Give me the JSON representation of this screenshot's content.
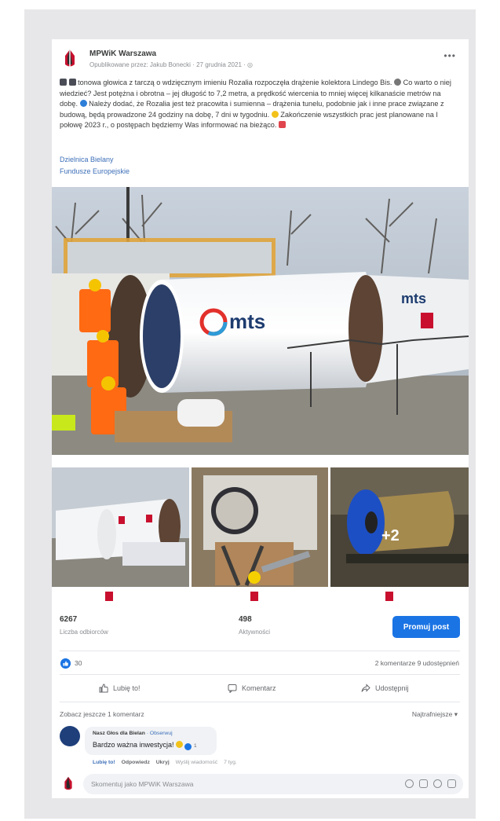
{
  "post": {
    "page_name": "MPWiK Warszawa",
    "meta": "Opublikowane przez: Jakub Bonecki · 27 grudnia 2021 ·",
    "text_1": "tonowa głowica z tarczą o wdzięcznym imieniu Rozalia rozpoczęła drążenie kolektora Lindego Bis.",
    "text_2": "Co warto o niej wiedzieć? Jest potężna i obrotna – jej długość to 7,2 metra, a prędkość wiercenia to mniej więcej kilkanaście metrów na dobę.",
    "text_3": "Należy dodać, że Rozalia jest też pracowita i sumienna – drążenia tunelu, podobnie jak i inne prace związane z budową, będą prowadzone 24 godziny na dobę, 7 dni w tygodniu.",
    "text_4": "Zakończenie wszystkich prac jest planowane na I połowę 2023 r., o postępach będziemy Was informować na bieżąco.",
    "tag_1": "Dzielnica Bielany",
    "tag_2": "Fundusze Europejskie",
    "more_photos": "+2",
    "photo_brand": "mts"
  },
  "stats": {
    "reach_value": "6267",
    "reach_label": "Liczba odbiorców",
    "engagement_value": "498",
    "engagement_label": "Aktywności",
    "promote_label": "Promuj post"
  },
  "reactions": {
    "likes": "30",
    "comments_shares": "2 komentarze  9 udostępnień"
  },
  "actions": {
    "like": "Lubię to!",
    "comment": "Komentarz",
    "share": "Udostępnij"
  },
  "comments": {
    "more_label": "Zobacz jeszcze 1 komentarz",
    "sort_label": "Najtrafniejsze ▾",
    "items": [
      {
        "author": "Nasz Głos dla Bielan",
        "follow": "· Obserwuj",
        "text": "Bardzo ważna inwestycja!",
        "reactions": "1",
        "like": "Lubię to!",
        "reply": "Odpowiedz",
        "hide": "Ukryj",
        "message": "Wyślij wiadomość",
        "time": "7 tyg."
      }
    ],
    "compose_placeholder": "Skomentuj jako MPWiK Warszawa"
  },
  "colors": {
    "accent": "#1b74e4",
    "link": "#3d6fb8",
    "brand_red": "#c8102e"
  }
}
